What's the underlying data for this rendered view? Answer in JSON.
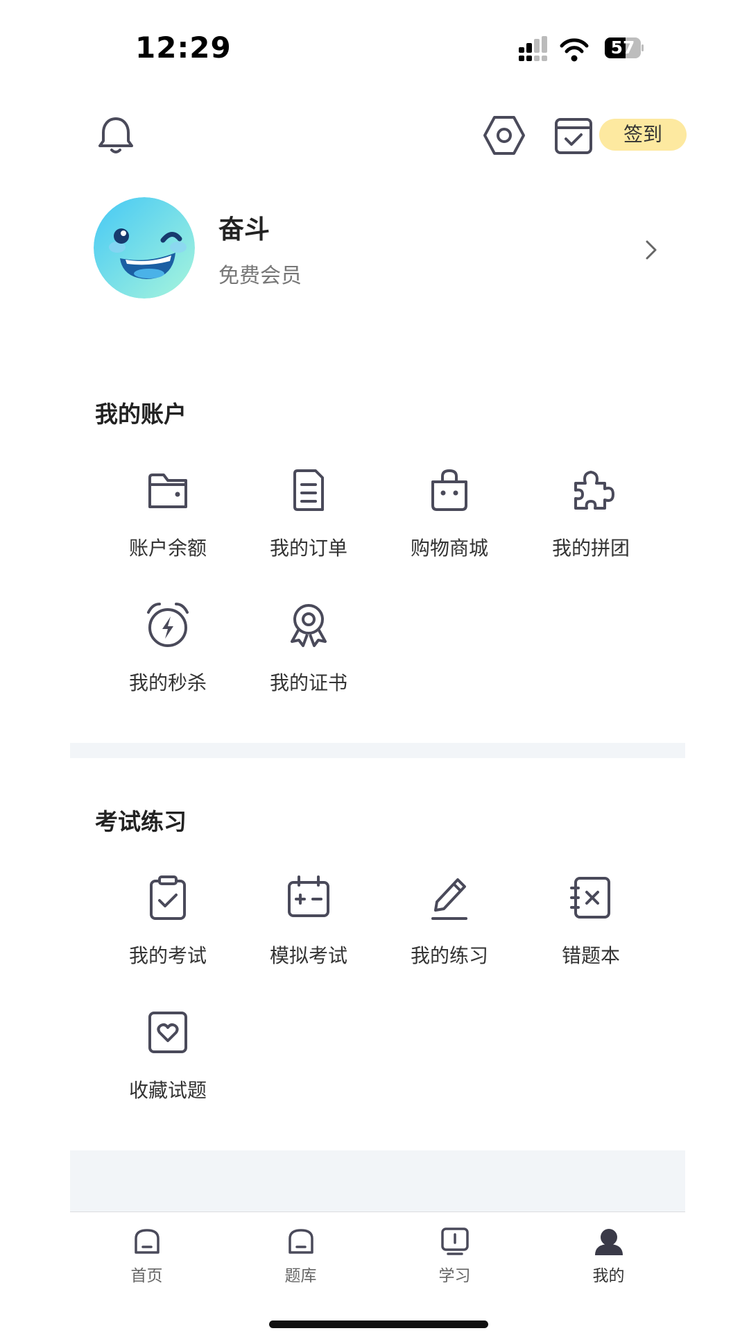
{
  "status_bar": {
    "time": "12:29",
    "battery": "57"
  },
  "header": {
    "checkin_label": "签到"
  },
  "profile": {
    "name": "奋斗",
    "level": "免费会员"
  },
  "account_section": {
    "title": "我的账户",
    "items": [
      {
        "label": "账户余额",
        "icon": "wallet-icon"
      },
      {
        "label": "我的订单",
        "icon": "order-document-icon"
      },
      {
        "label": "购物商城",
        "icon": "shopping-bag-icon"
      },
      {
        "label": "我的拼团",
        "icon": "puzzle-icon"
      },
      {
        "label": "我的秒杀",
        "icon": "alarm-flash-icon"
      },
      {
        "label": "我的证书",
        "icon": "certificate-badge-icon"
      }
    ]
  },
  "exam_section": {
    "title": "考试练习",
    "items": [
      {
        "label": "我的考试",
        "icon": "clipboard-check-icon"
      },
      {
        "label": "模拟考试",
        "icon": "calendar-plus-minus-icon"
      },
      {
        "label": "我的练习",
        "icon": "pencil-icon"
      },
      {
        "label": "错题本",
        "icon": "notebook-x-icon"
      },
      {
        "label": "收藏试题",
        "icon": "heart-box-icon"
      }
    ]
  },
  "tab_bar": {
    "tabs": [
      {
        "label": "首页",
        "icon": "home-icon",
        "active": false
      },
      {
        "label": "题库",
        "icon": "question-bank-icon",
        "active": false
      },
      {
        "label": "学习",
        "icon": "study-icon",
        "active": false
      },
      {
        "label": "我的",
        "icon": "profile-icon",
        "active": true
      }
    ]
  },
  "colors": {
    "icon_stroke": "#4a4a5a",
    "checkin_badge": "#fde9a0",
    "divider": "#f2f5f8",
    "text": "#333333"
  }
}
